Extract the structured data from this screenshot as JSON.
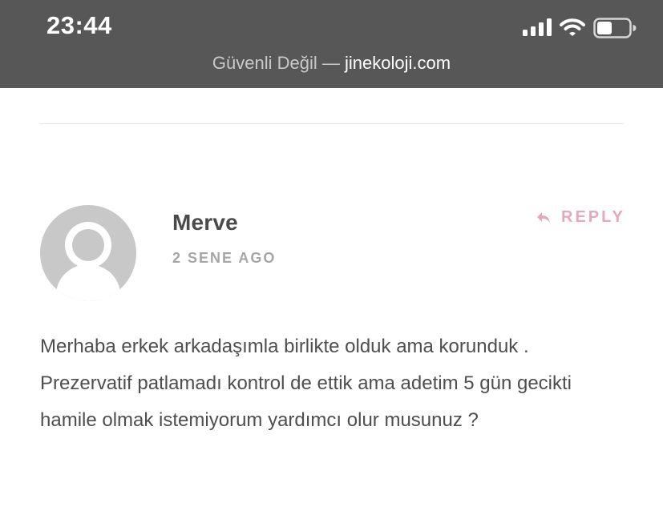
{
  "status_bar": {
    "time": "23:44",
    "icons": [
      "signal-icon",
      "wifi-icon",
      "battery-icon"
    ],
    "url_label": "Güvenli Değil —",
    "url_domain": "jinekoloji.com"
  },
  "comment": {
    "author": "Merve",
    "date": "2 SENE AGO",
    "reply_label": "REPLY",
    "lines": [
      "Merhaba erkek arkadaşımla birlikte olduk ama korunduk .",
      "Prezervatif patlamadı kontrol de ettik ama adetim 5 gün gecikti",
      "hamile olmak istemiyorum yardımcı olur musunuz ?"
    ]
  },
  "colors": {
    "status_bar_bg": "#575757",
    "reply_accent": "#e8a8bc",
    "avatar_bg": "#c8c8c8",
    "text": "#4e4e4e"
  }
}
